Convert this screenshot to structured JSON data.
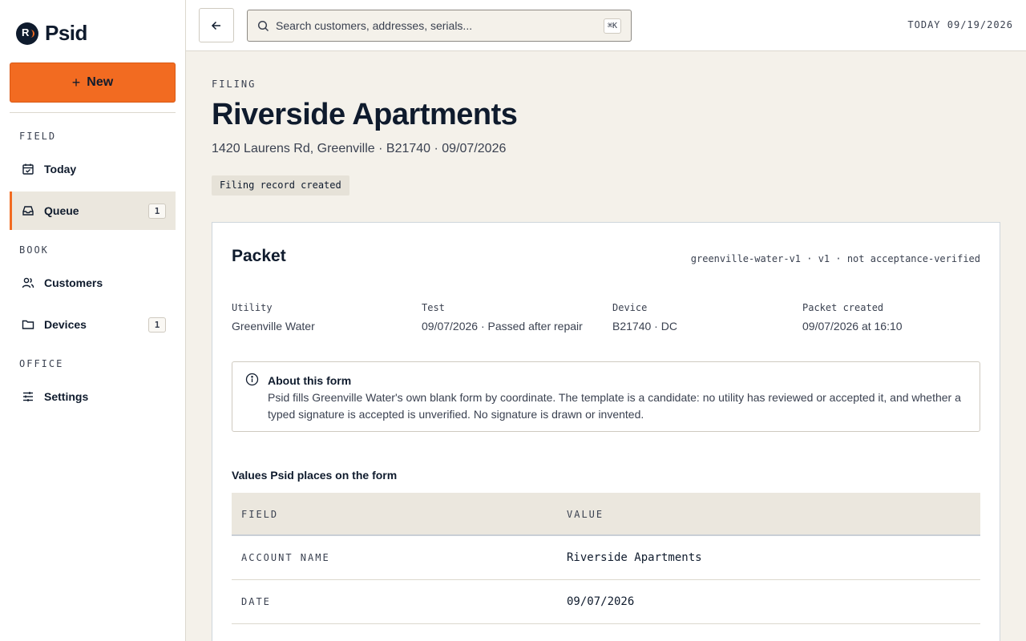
{
  "brand": {
    "name": "Psid",
    "mark": "R"
  },
  "sidebar": {
    "new_label": "New",
    "sections": [
      {
        "label": "FIELD",
        "items": [
          {
            "label": "Today",
            "icon": "calendar-check-icon"
          },
          {
            "label": "Queue",
            "icon": "inbox-icon",
            "count": "1",
            "active": true
          }
        ]
      },
      {
        "label": "BOOK",
        "items": [
          {
            "label": "Customers",
            "icon": "users-icon"
          },
          {
            "label": "Devices",
            "icon": "folder-icon",
            "count": "1"
          }
        ]
      },
      {
        "label": "OFFICE",
        "items": [
          {
            "label": "Settings",
            "icon": "sliders-icon"
          }
        ]
      }
    ]
  },
  "topbar": {
    "search_placeholder": "Search customers, addresses, serials...",
    "shortcut": "⌘K",
    "today": "TODAY 09/19/2026"
  },
  "page": {
    "kicker": "FILING",
    "title": "Riverside Apartments",
    "subtitle": "1420 Laurens Rd, Greenville · B21740 · 09/07/2026",
    "status": "Filing record created"
  },
  "packet": {
    "title": "Packet",
    "meta": "greenville-water-v1 · v1 · not acceptance-verified",
    "facts": [
      {
        "label": "Utility",
        "value": "Greenville Water"
      },
      {
        "label": "Test",
        "value": "09/07/2026 · Passed after repair"
      },
      {
        "label": "Device",
        "value": "B21740 · DC"
      },
      {
        "label": "Packet created",
        "value": "09/07/2026 at 16:10"
      }
    ],
    "info": {
      "title": "About this form",
      "body": "Psid fills Greenville Water's own blank form by coordinate. The template is a candidate: no utility has reviewed or accepted it, and whether a typed signature is accepted is unverified. No signature is drawn or invented."
    },
    "values_label": "Values Psid places on the form",
    "table": {
      "headers": [
        "FIELD",
        "VALUE"
      ],
      "rows": [
        {
          "field": "ACCOUNT NAME",
          "value": "Riverside Apartments"
        },
        {
          "field": "DATE",
          "value": "09/07/2026"
        }
      ]
    }
  },
  "colors": {
    "accent": "#f26b21",
    "ink": "#0f1b2d",
    "canvas": "#f4f1ea"
  }
}
